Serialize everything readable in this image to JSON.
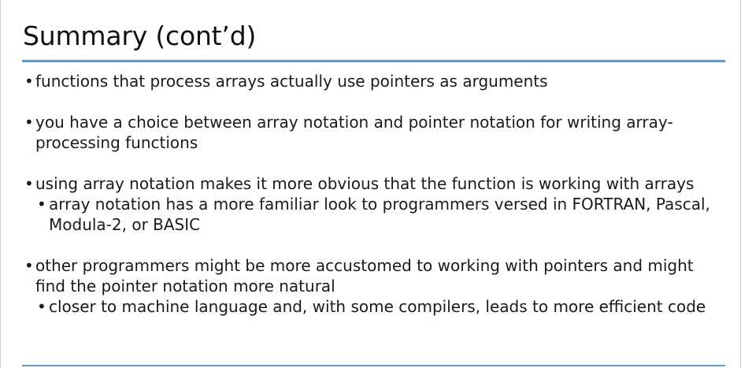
{
  "slide": {
    "title": "Summary (cont’d)",
    "bullet_glyph": "•",
    "accent_color": "#5b9bd5",
    "bullets": [
      {
        "text": "functions that process arrays actually use pointers as arguments"
      },
      {
        "text": "you have a choice between array notation and pointer notation for writing array-processing functions"
      },
      {
        "text": "using array notation makes it more obvious that the function is working with arrays",
        "sub": "array notation has a more familiar look to programmers versed in FORTRAN, Pascal, Modula-2, or BASIC"
      },
      {
        "text": "other programmers might be more accustomed to working with pointers and might find the pointer notation more natural",
        "sub": "closer to machine language and, with some compilers, leads to more efficient code"
      }
    ]
  }
}
